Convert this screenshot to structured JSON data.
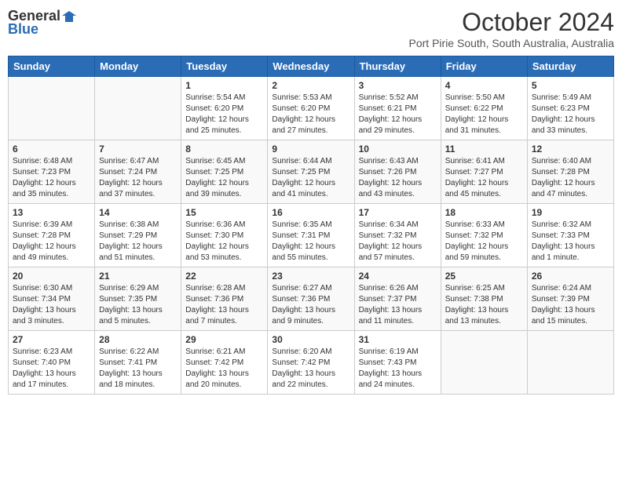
{
  "header": {
    "logo_general": "General",
    "logo_blue": "Blue",
    "month": "October 2024",
    "location": "Port Pirie South, South Australia, Australia"
  },
  "weekdays": [
    "Sunday",
    "Monday",
    "Tuesday",
    "Wednesday",
    "Thursday",
    "Friday",
    "Saturday"
  ],
  "weeks": [
    [
      {
        "day": "",
        "info": ""
      },
      {
        "day": "",
        "info": ""
      },
      {
        "day": "1",
        "info": "Sunrise: 5:54 AM\nSunset: 6:20 PM\nDaylight: 12 hours and 25 minutes."
      },
      {
        "day": "2",
        "info": "Sunrise: 5:53 AM\nSunset: 6:20 PM\nDaylight: 12 hours and 27 minutes."
      },
      {
        "day": "3",
        "info": "Sunrise: 5:52 AM\nSunset: 6:21 PM\nDaylight: 12 hours and 29 minutes."
      },
      {
        "day": "4",
        "info": "Sunrise: 5:50 AM\nSunset: 6:22 PM\nDaylight: 12 hours and 31 minutes."
      },
      {
        "day": "5",
        "info": "Sunrise: 5:49 AM\nSunset: 6:23 PM\nDaylight: 12 hours and 33 minutes."
      }
    ],
    [
      {
        "day": "6",
        "info": "Sunrise: 6:48 AM\nSunset: 7:23 PM\nDaylight: 12 hours and 35 minutes."
      },
      {
        "day": "7",
        "info": "Sunrise: 6:47 AM\nSunset: 7:24 PM\nDaylight: 12 hours and 37 minutes."
      },
      {
        "day": "8",
        "info": "Sunrise: 6:45 AM\nSunset: 7:25 PM\nDaylight: 12 hours and 39 minutes."
      },
      {
        "day": "9",
        "info": "Sunrise: 6:44 AM\nSunset: 7:25 PM\nDaylight: 12 hours and 41 minutes."
      },
      {
        "day": "10",
        "info": "Sunrise: 6:43 AM\nSunset: 7:26 PM\nDaylight: 12 hours and 43 minutes."
      },
      {
        "day": "11",
        "info": "Sunrise: 6:41 AM\nSunset: 7:27 PM\nDaylight: 12 hours and 45 minutes."
      },
      {
        "day": "12",
        "info": "Sunrise: 6:40 AM\nSunset: 7:28 PM\nDaylight: 12 hours and 47 minutes."
      }
    ],
    [
      {
        "day": "13",
        "info": "Sunrise: 6:39 AM\nSunset: 7:28 PM\nDaylight: 12 hours and 49 minutes."
      },
      {
        "day": "14",
        "info": "Sunrise: 6:38 AM\nSunset: 7:29 PM\nDaylight: 12 hours and 51 minutes."
      },
      {
        "day": "15",
        "info": "Sunrise: 6:36 AM\nSunset: 7:30 PM\nDaylight: 12 hours and 53 minutes."
      },
      {
        "day": "16",
        "info": "Sunrise: 6:35 AM\nSunset: 7:31 PM\nDaylight: 12 hours and 55 minutes."
      },
      {
        "day": "17",
        "info": "Sunrise: 6:34 AM\nSunset: 7:32 PM\nDaylight: 12 hours and 57 minutes."
      },
      {
        "day": "18",
        "info": "Sunrise: 6:33 AM\nSunset: 7:32 PM\nDaylight: 12 hours and 59 minutes."
      },
      {
        "day": "19",
        "info": "Sunrise: 6:32 AM\nSunset: 7:33 PM\nDaylight: 13 hours and 1 minute."
      }
    ],
    [
      {
        "day": "20",
        "info": "Sunrise: 6:30 AM\nSunset: 7:34 PM\nDaylight: 13 hours and 3 minutes."
      },
      {
        "day": "21",
        "info": "Sunrise: 6:29 AM\nSunset: 7:35 PM\nDaylight: 13 hours and 5 minutes."
      },
      {
        "day": "22",
        "info": "Sunrise: 6:28 AM\nSunset: 7:36 PM\nDaylight: 13 hours and 7 minutes."
      },
      {
        "day": "23",
        "info": "Sunrise: 6:27 AM\nSunset: 7:36 PM\nDaylight: 13 hours and 9 minutes."
      },
      {
        "day": "24",
        "info": "Sunrise: 6:26 AM\nSunset: 7:37 PM\nDaylight: 13 hours and 11 minutes."
      },
      {
        "day": "25",
        "info": "Sunrise: 6:25 AM\nSunset: 7:38 PM\nDaylight: 13 hours and 13 minutes."
      },
      {
        "day": "26",
        "info": "Sunrise: 6:24 AM\nSunset: 7:39 PM\nDaylight: 13 hours and 15 minutes."
      }
    ],
    [
      {
        "day": "27",
        "info": "Sunrise: 6:23 AM\nSunset: 7:40 PM\nDaylight: 13 hours and 17 minutes."
      },
      {
        "day": "28",
        "info": "Sunrise: 6:22 AM\nSunset: 7:41 PM\nDaylight: 13 hours and 18 minutes."
      },
      {
        "day": "29",
        "info": "Sunrise: 6:21 AM\nSunset: 7:42 PM\nDaylight: 13 hours and 20 minutes."
      },
      {
        "day": "30",
        "info": "Sunrise: 6:20 AM\nSunset: 7:42 PM\nDaylight: 13 hours and 22 minutes."
      },
      {
        "day": "31",
        "info": "Sunrise: 6:19 AM\nSunset: 7:43 PM\nDaylight: 13 hours and 24 minutes."
      },
      {
        "day": "",
        "info": ""
      },
      {
        "day": "",
        "info": ""
      }
    ]
  ]
}
